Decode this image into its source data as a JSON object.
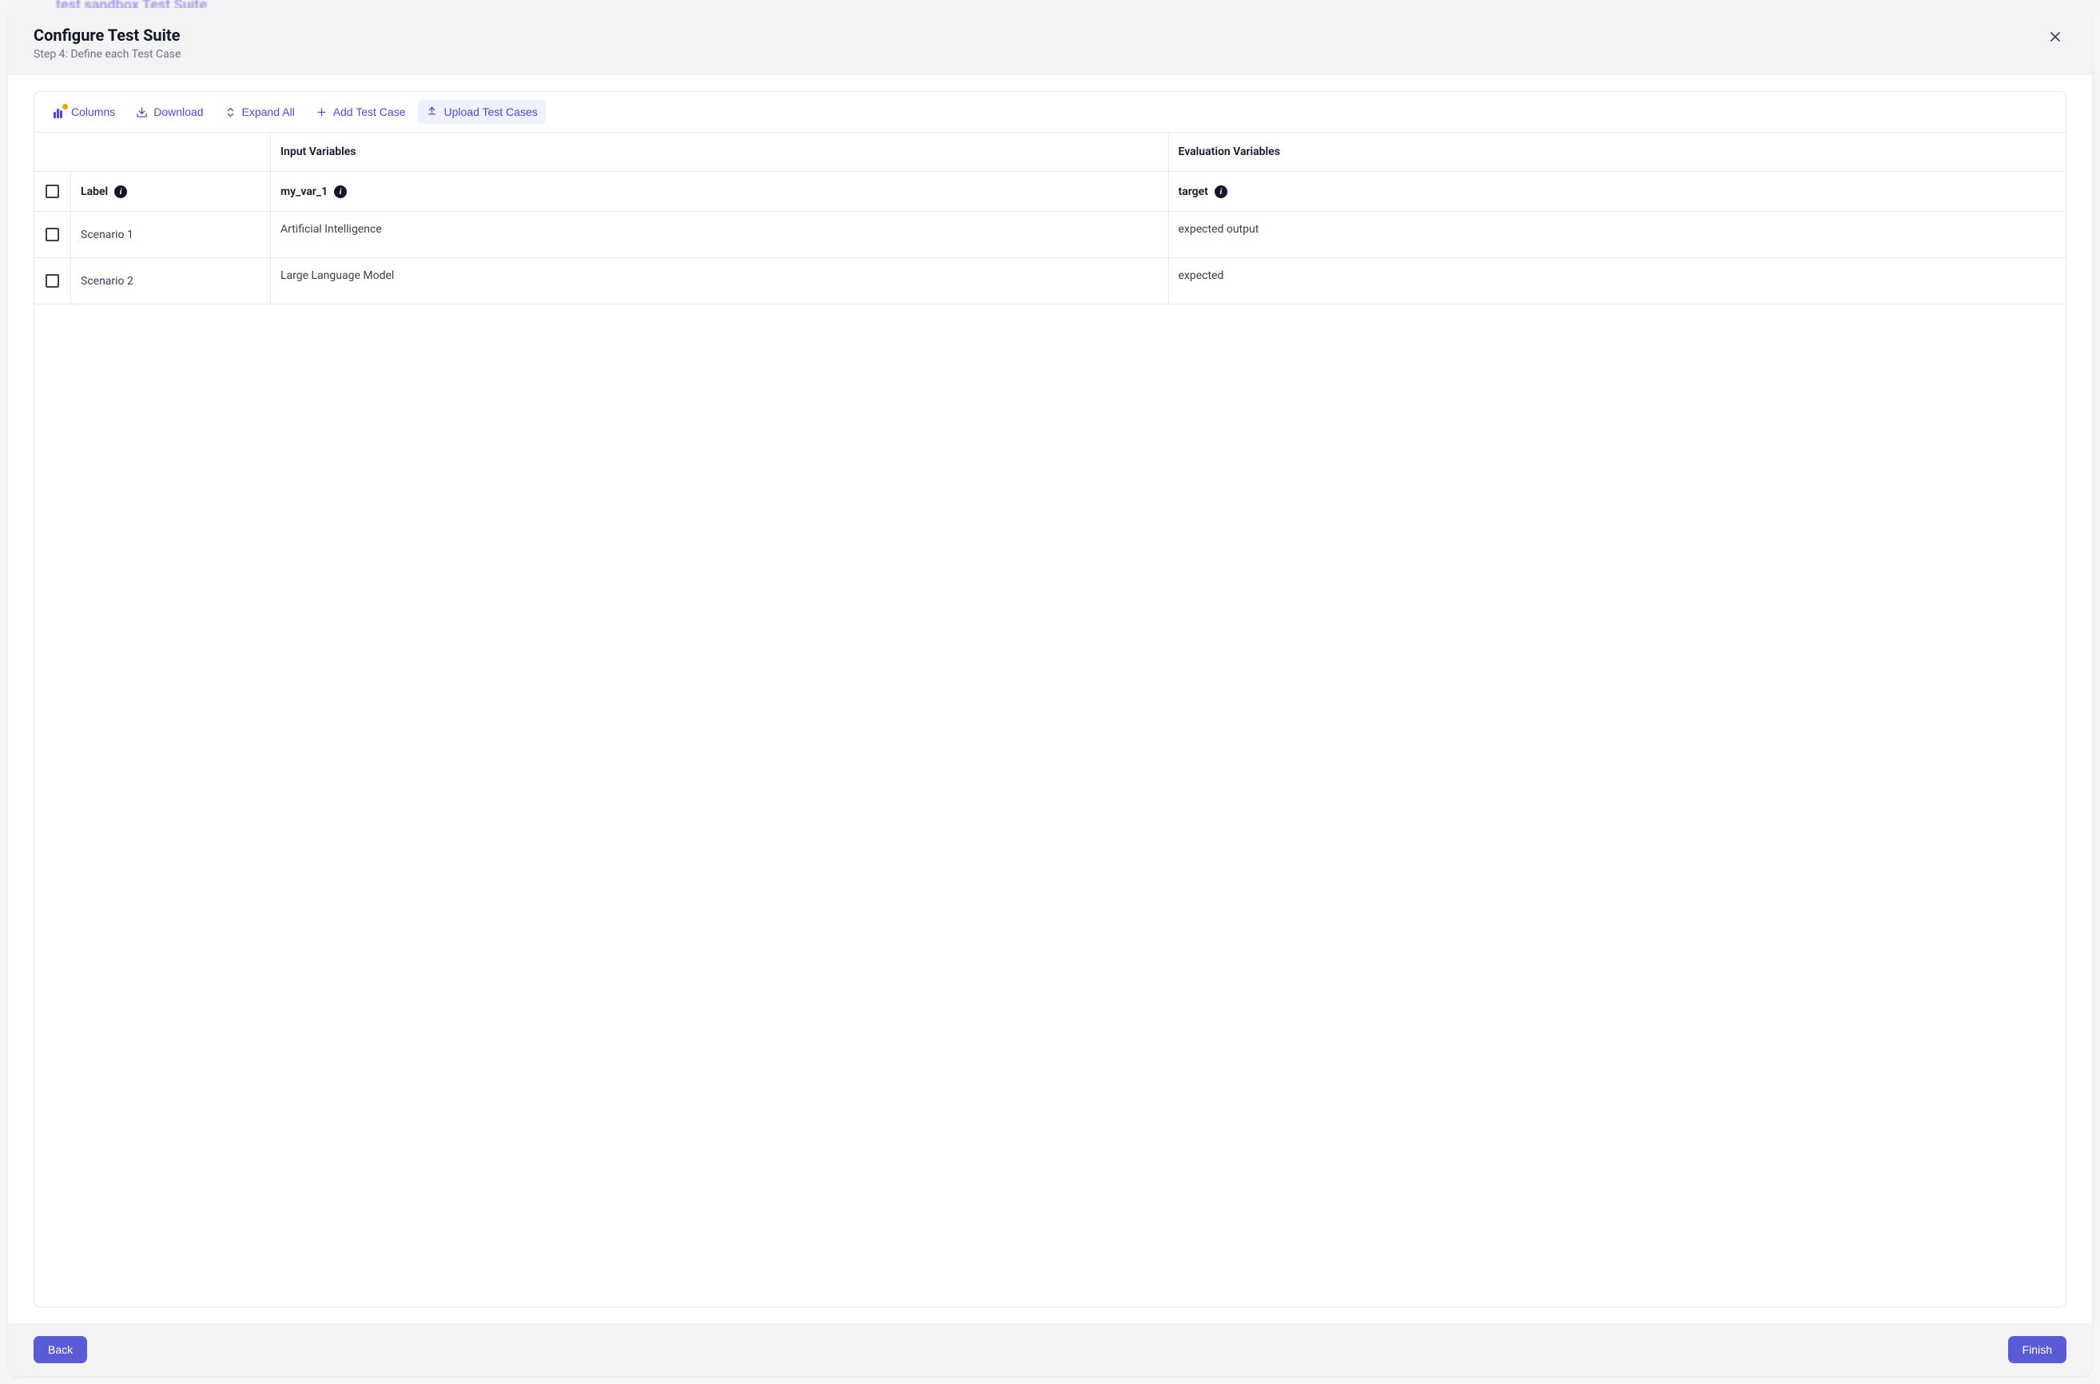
{
  "backdrop_hint": "test sandbox Test Suite",
  "modal": {
    "title": "Configure Test Suite",
    "subtitle": "Step 4: Define each Test Case"
  },
  "toolbar": {
    "columns": "Columns",
    "download": "Download",
    "expand_all": "Expand All",
    "add_test_case": "Add Test Case",
    "upload_test_cases": "Upload Test Cases"
  },
  "headers": {
    "input_variables": "Input Variables",
    "evaluation_variables": "Evaluation Variables",
    "label": "Label",
    "input_col": "my_var_1",
    "eval_col": "target"
  },
  "rows": [
    {
      "label": "Scenario 1",
      "input": "Artificial Intelligence",
      "eval": "expected output"
    },
    {
      "label": "Scenario 2",
      "input": "Large Language Model",
      "eval": "expected"
    }
  ],
  "footer": {
    "back": "Back",
    "finish": "Finish"
  }
}
